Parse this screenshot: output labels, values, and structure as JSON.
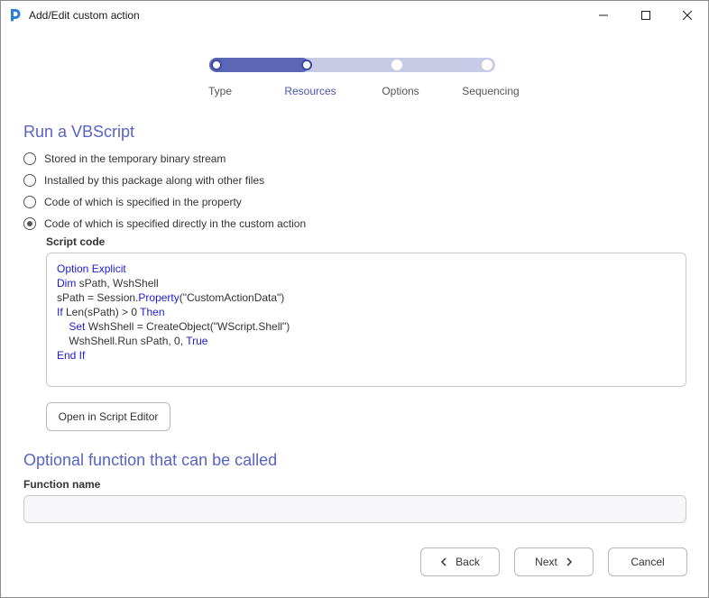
{
  "window": {
    "title": "Add/Edit custom action"
  },
  "stepper": {
    "steps": [
      "Type",
      "Resources",
      "Options",
      "Sequencing"
    ],
    "current_step": 2,
    "progress_percent": 35,
    "colors": {
      "done": "#5b67b6",
      "pending": "#c7cbe6",
      "current_label": "#4a56b0"
    }
  },
  "section1": {
    "title": "Run a VBScript",
    "options": [
      {
        "label": "Stored in the temporary binary stream",
        "checked": false
      },
      {
        "label": "Installed by this package along with other files",
        "checked": false
      },
      {
        "label": "Code of which is specified in the property",
        "checked": false
      },
      {
        "label": "Code of which is specified directly in the custom action",
        "checked": true
      }
    ],
    "script_label": "Script code",
    "script_lines": [
      [
        {
          "t": "Option Explicit",
          "k": true
        }
      ],
      [
        {
          "t": "Dim",
          "k": true
        },
        {
          "t": " sPath, WshShell",
          "k": false
        }
      ],
      [
        {
          "t": "sPath = Session.",
          "k": false
        },
        {
          "t": "Property",
          "k": true
        },
        {
          "t": "(\"CustomActionData\")",
          "k": false
        }
      ],
      [
        {
          "t": "If",
          "k": true
        },
        {
          "t": " Len(sPath) > 0 ",
          "k": false
        },
        {
          "t": "Then",
          "k": true
        }
      ],
      [
        {
          "t": "    ",
          "k": false
        },
        {
          "t": "Set",
          "k": true
        },
        {
          "t": " WshShell = CreateObject(\"WScript.Shell\")",
          "k": false
        }
      ],
      [
        {
          "t": "    WshShell.Run sPath, 0, ",
          "k": false
        },
        {
          "t": "True",
          "k": true
        }
      ],
      [
        {
          "t": "End If",
          "k": true
        }
      ]
    ],
    "open_editor_label": "Open in Script Editor"
  },
  "section2": {
    "title": "Optional function that can be called",
    "function_label": "Function name",
    "function_value": ""
  },
  "footer": {
    "back_label": "Back",
    "next_label": "Next",
    "cancel_label": "Cancel"
  },
  "icons": {
    "app": "app-logo-icon",
    "minimize": "minimize-icon",
    "maximize": "maximize-icon",
    "close": "close-icon",
    "back": "chevron-left-icon",
    "next": "chevron-right-icon"
  },
  "colors": {
    "accent": "#5863c2",
    "keyword": "#1b1bd6"
  }
}
